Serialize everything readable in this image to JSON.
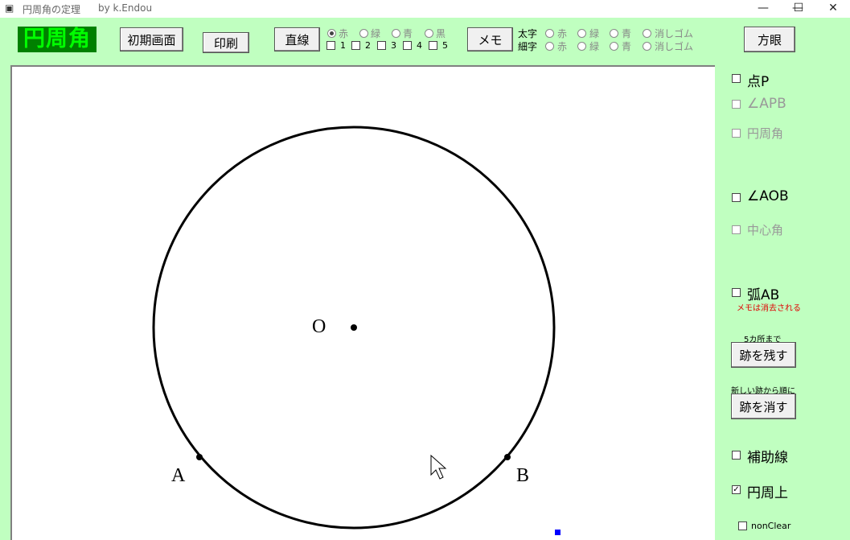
{
  "window": {
    "title": "円周角の定理",
    "author": "by k.Endou",
    "minimize": "—",
    "maximize": "☐",
    "close": "✕"
  },
  "toolbar": {
    "logo": "円周角",
    "home_button": "初期画面",
    "print_button": "印刷",
    "line_button": "直線",
    "line_colors": [
      "赤",
      "緑",
      "青",
      "黒"
    ],
    "line_numbers": [
      "1",
      "2",
      "3",
      "4",
      "5"
    ],
    "memo_button": "メモ",
    "thick_label": "太字",
    "thin_label": "細字",
    "memo_colors": [
      "赤",
      "緑",
      "青",
      "消しゴム"
    ],
    "grid_button": "方眼"
  },
  "canvas": {
    "label_O": "O",
    "label_A": "A",
    "label_B": "B"
  },
  "side": {
    "point_p": "点P",
    "angle_apb": "∠APB",
    "inscribed_angle": "円周角",
    "angle_aob": "∠AOB",
    "central_angle": "中心角",
    "arc_ab": "弧AB",
    "memo_note": "メモは消去される",
    "trace_limit": "5カ所まで",
    "keep_trace": "跡を残す",
    "erase_order": "新しい跡から順に",
    "erase_trace": "跡を消す",
    "aux_line": "補助線",
    "on_circle": "円周上",
    "on_circle_check": "✓",
    "nonclear": "nonClear"
  },
  "colors": {
    "background": "#c0ffc0",
    "logo_bg": "#008000",
    "logo_fg": "#00ff00",
    "note_red": "#e00000"
  }
}
